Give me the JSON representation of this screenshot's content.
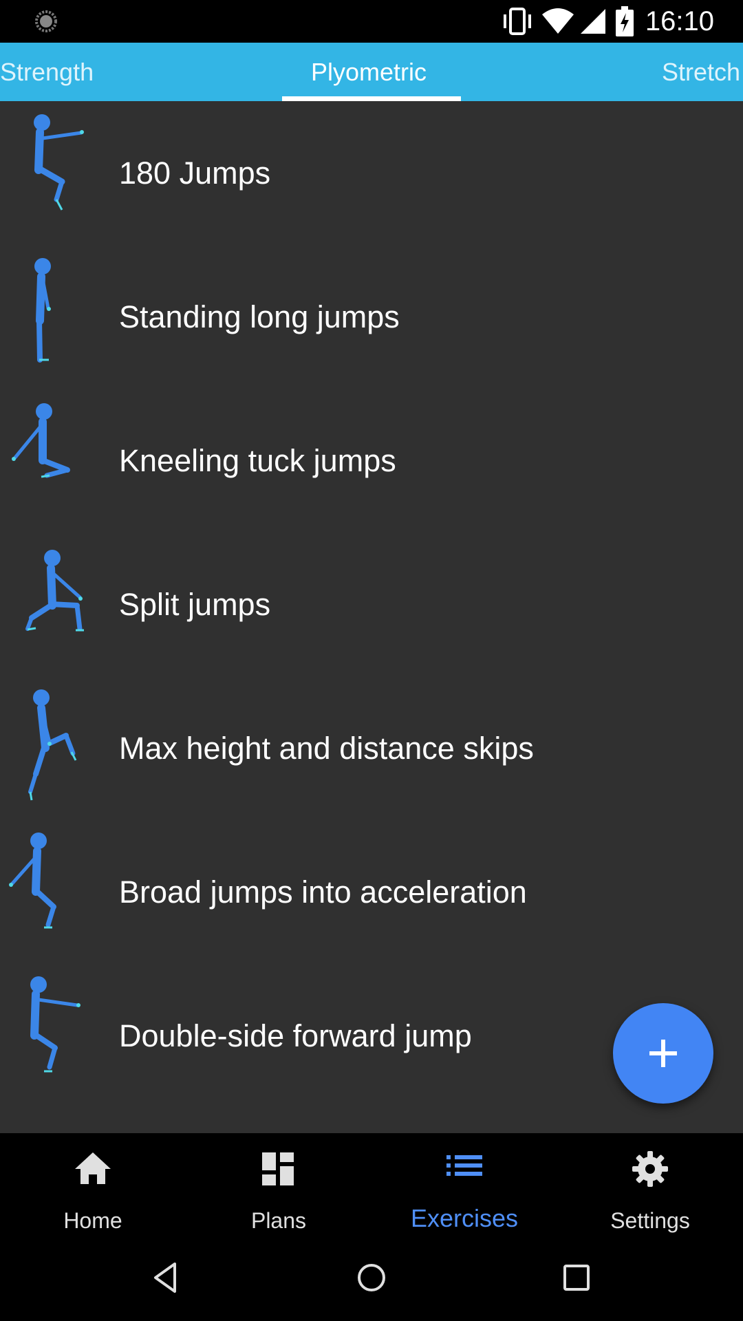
{
  "status_bar": {
    "time": "16:10",
    "icons": [
      "loading-icon",
      "vibrate-icon",
      "wifi-icon",
      "signal-icon",
      "battery-charging-icon"
    ]
  },
  "tabs": [
    {
      "label": "Strength",
      "active": false
    },
    {
      "label": "Plyometric",
      "active": true
    },
    {
      "label": "Stretch",
      "active": false
    }
  ],
  "exercises": [
    {
      "name": "180 Jumps",
      "icon": "squat-figure-icon"
    },
    {
      "name": "Standing long jumps",
      "icon": "standing-figure-icon"
    },
    {
      "name": "Kneeling tuck jumps",
      "icon": "kneeling-figure-icon"
    },
    {
      "name": "Split jumps",
      "icon": "lunge-figure-icon"
    },
    {
      "name": "Max height and distance skips",
      "icon": "skip-figure-icon"
    },
    {
      "name": "Broad jumps into acceleration",
      "icon": "broad-jump-figure-icon"
    },
    {
      "name": "Double-side forward jump",
      "icon": "squat-figure-icon"
    }
  ],
  "fab": {
    "icon": "plus-icon"
  },
  "bottom_nav": [
    {
      "label": "Home",
      "icon": "home-icon",
      "active": false
    },
    {
      "label": "Plans",
      "icon": "dashboard-icon",
      "active": false
    },
    {
      "label": "Exercises",
      "icon": "list-icon",
      "active": true
    },
    {
      "label": "Settings",
      "icon": "gear-icon",
      "active": false
    }
  ],
  "colors": {
    "tab_bar": "#33b5e5",
    "list_background": "#303030",
    "accent": "#4285f4",
    "figure": "#3b86e8",
    "figure_joint": "#4fd9e8"
  }
}
